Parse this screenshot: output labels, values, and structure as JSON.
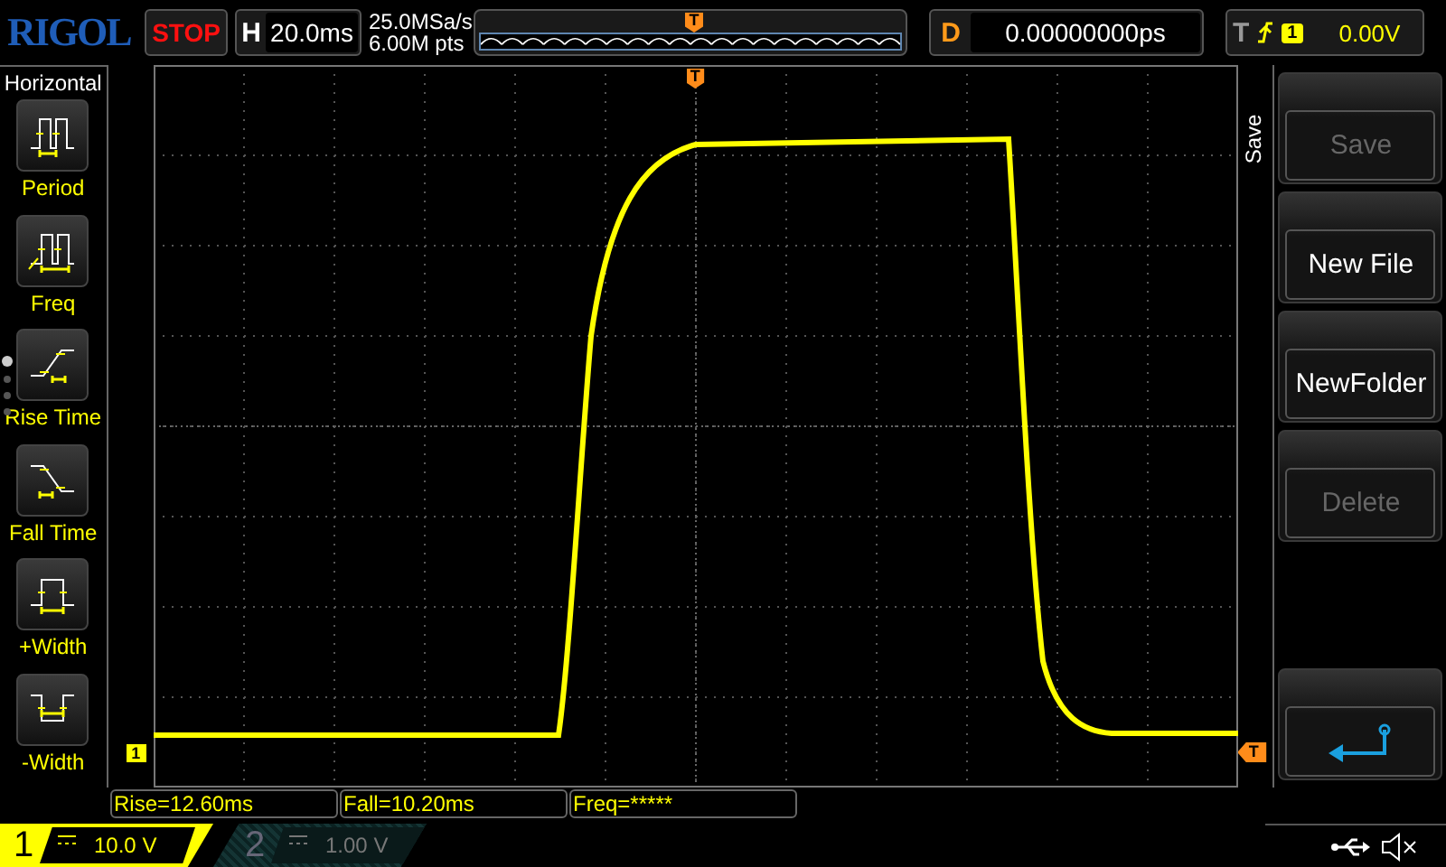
{
  "logo": "RIGOL",
  "run_state": "STOP",
  "horizontal": {
    "label": "H",
    "timebase": "20.0ms",
    "sample_rate": "25.0MSa/s",
    "memory_depth": "6.00M pts",
    "timeline_marker": "T"
  },
  "delay": {
    "label": "D",
    "value": "0.00000000ps"
  },
  "trigger": {
    "label": "T",
    "source": "1",
    "level": "0.00V"
  },
  "measure_panel": {
    "title": "Horizontal",
    "pages": [
      {
        "selected": true
      },
      {
        "selected": false
      },
      {
        "selected": false
      },
      {
        "selected": false
      }
    ],
    "items": [
      {
        "label": "Period",
        "kind": "period"
      },
      {
        "label": "Freq",
        "kind": "freq"
      },
      {
        "label": "Rise Time",
        "kind": "rise"
      },
      {
        "label": "Fall Time",
        "kind": "fall"
      },
      {
        "label": "+Width",
        "kind": "pwidth"
      },
      {
        "label": "-Width",
        "kind": "nwidth"
      }
    ]
  },
  "plot": {
    "trigger_position_marker": "T",
    "trigger_level_marker": "T",
    "channel_marker": "1"
  },
  "measurements": [
    "Rise=12.60ms",
    "Fall=10.20ms",
    "Freq=*****"
  ],
  "channels": [
    {
      "number": "1",
      "scale": "10.0 V",
      "active": true
    },
    {
      "number": "2",
      "scale": "1.00 V",
      "active": false
    }
  ],
  "menu": {
    "title": "Save",
    "buttons": [
      {
        "kind": "text",
        "label": "Save",
        "disabled": true
      },
      {
        "kind": "text",
        "label": "New File",
        "disabled": false
      },
      {
        "kind": "text",
        "label": "NewFolder",
        "disabled": false
      },
      {
        "kind": "text",
        "label": "Delete",
        "disabled": true
      },
      {
        "kind": "back"
      }
    ]
  }
}
